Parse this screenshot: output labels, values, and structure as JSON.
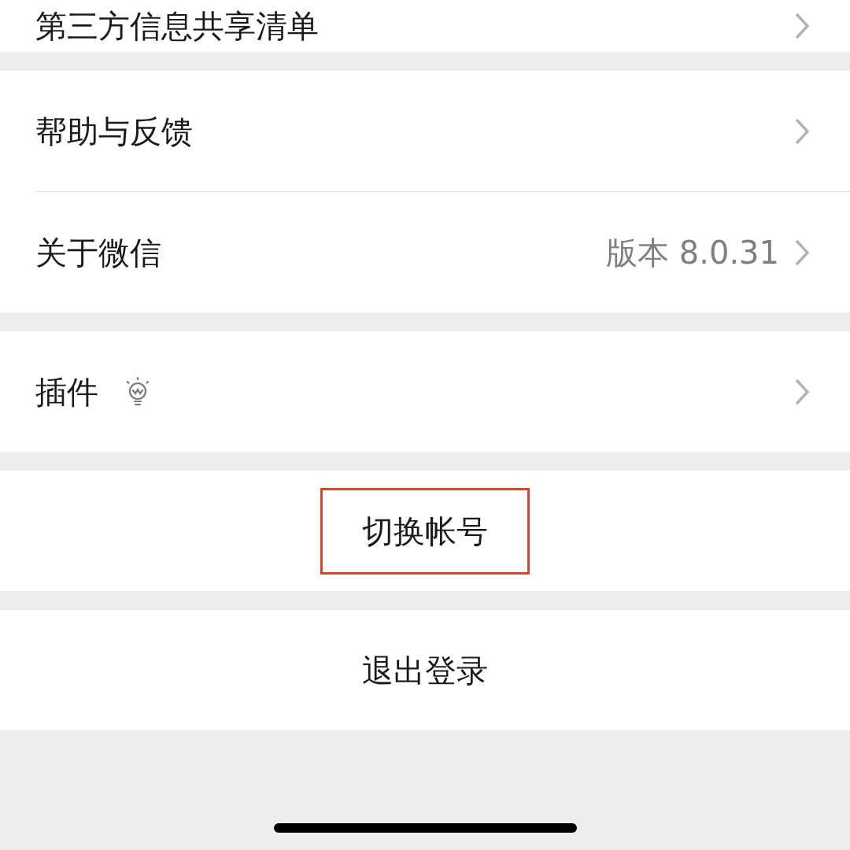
{
  "groups": [
    {
      "items": [
        {
          "kind": "nav",
          "label": "第三方信息共享清单"
        }
      ]
    },
    {
      "items": [
        {
          "kind": "nav",
          "label": "帮助与反馈"
        },
        {
          "kind": "nav",
          "label": "关于微信",
          "value": "版本 8.0.31"
        }
      ]
    },
    {
      "items": [
        {
          "kind": "nav_icon",
          "label": "插件"
        }
      ]
    },
    {
      "items": [
        {
          "kind": "action",
          "label": "切换帐号",
          "highlighted": true
        }
      ]
    },
    {
      "items": [
        {
          "kind": "action",
          "label": "退出登录",
          "highlighted": false
        }
      ]
    }
  ]
}
